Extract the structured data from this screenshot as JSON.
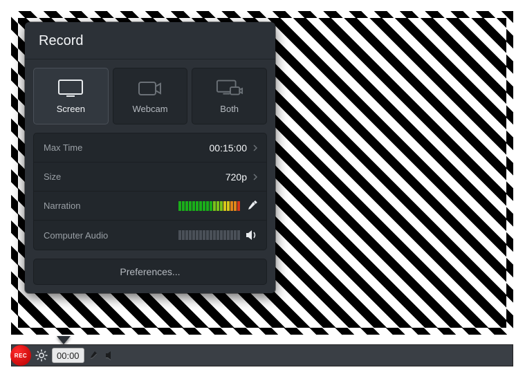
{
  "panel": {
    "title": "Record",
    "modes": [
      {
        "label": "Screen",
        "active": true
      },
      {
        "label": "Webcam",
        "active": false
      },
      {
        "label": "Both",
        "active": false
      }
    ],
    "settings": {
      "max_time": {
        "label": "Max Time",
        "value": "00:15:00"
      },
      "size": {
        "label": "Size",
        "value": "720p"
      },
      "narration": {
        "label": "Narration",
        "level_segments": 18,
        "active": true
      },
      "computer_audio": {
        "label": "Computer Audio",
        "level_segments": 18,
        "active": false
      }
    },
    "preferences_label": "Preferences..."
  },
  "statusbar": {
    "rec_label": "REC",
    "timer": "00:00"
  },
  "colors": {
    "panel_bg": "#2c3137",
    "rec_red": "#d30000"
  }
}
